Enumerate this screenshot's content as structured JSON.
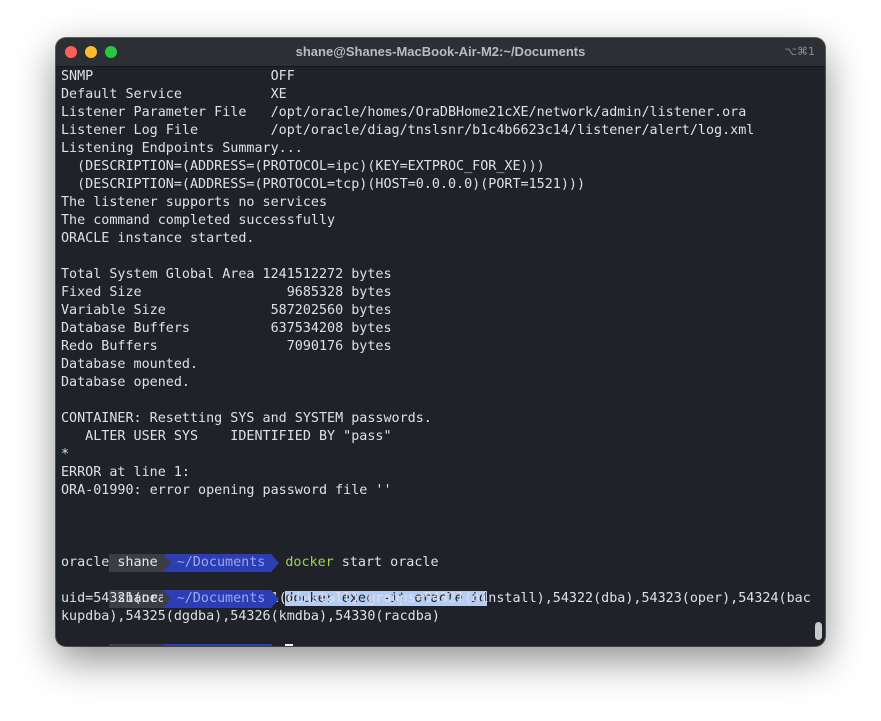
{
  "window": {
    "title": "shane@Shanes-MacBook-Air-M2:~/Documents",
    "shortcut": "⌥⌘1"
  },
  "terminal": {
    "lines": [
      "SNMP                      OFF",
      "Default Service           XE",
      "Listener Parameter File   /opt/oracle/homes/OraDBHome21cXE/network/admin/listener.ora",
      "Listener Log File         /opt/oracle/diag/tnslsnr/b1c4b6623c14/listener/alert/log.xml",
      "Listening Endpoints Summary...",
      "  (DESCRIPTION=(ADDRESS=(PROTOCOL=ipc)(KEY=EXTPROC_FOR_XE)))",
      "  (DESCRIPTION=(ADDRESS=(PROTOCOL=tcp)(HOST=0.0.0.0)(PORT=1521)))",
      "The listener supports no services",
      "The command completed successfully",
      "ORACLE instance started.",
      "",
      "Total System Global Area 1241512272 bytes",
      "Fixed Size                  9685328 bytes",
      "Variable Size             587202560 bytes",
      "Database Buffers          637534208 bytes",
      "Redo Buffers                7090176 bytes",
      "Database mounted.",
      "Database opened.",
      "",
      "CONTAINER: Resetting SYS and SYSTEM passwords.",
      "   ALTER USER SYS    IDENTIFIED BY \"pass\"",
      "*",
      "ERROR at line 1:",
      "ORA-01990: error opening password file ''",
      "",
      ""
    ],
    "prompt_user": "shane",
    "prompt_dir": "~/Documents",
    "cmd1_name": "docker",
    "cmd1_args": " start oracle",
    "out1": "oracle",
    "cmd2": "docker exec -it oracle id",
    "out2_line1": "uid=54321(oracle) gid=54321(oinstall) groups=54321(oinstall),54322(dba),54323(oper),54324(bac",
    "out2_line2": "kupdba),54325(dgdba),54326(kmdba),54330(racdba)"
  }
}
